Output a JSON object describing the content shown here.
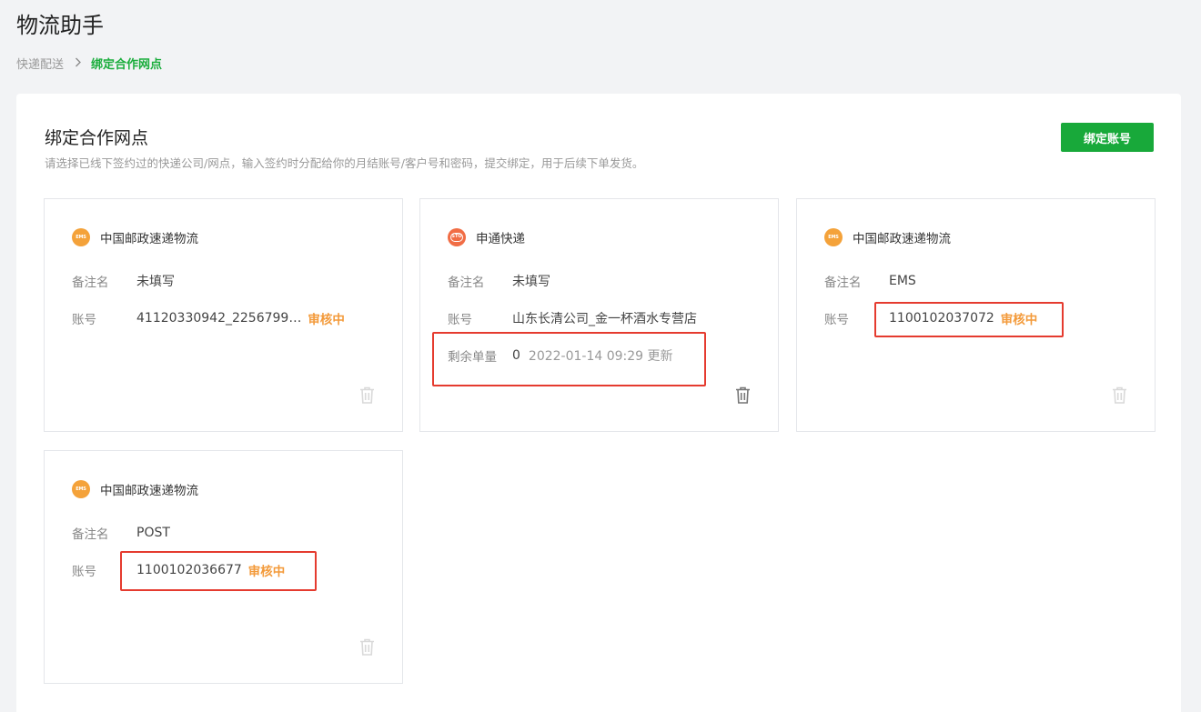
{
  "app_title": "物流助手",
  "breadcrumb": {
    "parent": "快递配送",
    "current": "绑定合作网点"
  },
  "panel": {
    "title": "绑定合作网点",
    "description": "请选择已线下签约过的快递公司/网点，输入签约时分配给你的月结账号/客户号和密码，提交绑定，用于后续下单发货。",
    "bind_button": "绑定账号"
  },
  "labels": {
    "remark": "备注名",
    "account": "账号",
    "remaining": "剩余单量"
  },
  "cards": [
    {
      "company": "中国邮政速递物流",
      "logo_icon": "ems-logo-icon",
      "logo_text": "EMS",
      "remark": "未填写",
      "account": "41120330942_2256799…",
      "status": "审核中",
      "delete_enabled": false
    },
    {
      "company": "申通快递",
      "logo_icon": "sto-logo-icon",
      "logo_text": "STO",
      "remark": "未填写",
      "account": "山东长清公司_金一杯酒水专营店",
      "remaining": "0",
      "updated": "2022-01-14 09:29 更新",
      "delete_enabled": true
    },
    {
      "company": "中国邮政速递物流",
      "logo_icon": "ems-logo-icon",
      "logo_text": "EMS",
      "remark": "EMS",
      "account": "1100102037072",
      "status": "审核中",
      "delete_enabled": false
    },
    {
      "company": "中国邮政速递物流",
      "logo_icon": "ems-logo-icon",
      "logo_text": "EMS",
      "remark": "POST",
      "account": "1100102036677",
      "status": "审核中",
      "delete_enabled": false
    }
  ],
  "colors": {
    "accent_green": "#18a93a",
    "status_orange": "#f39a3a",
    "highlight_red": "#e53b2f",
    "ems_orange": "#f4a23a",
    "sto_red": "#f16d45"
  }
}
